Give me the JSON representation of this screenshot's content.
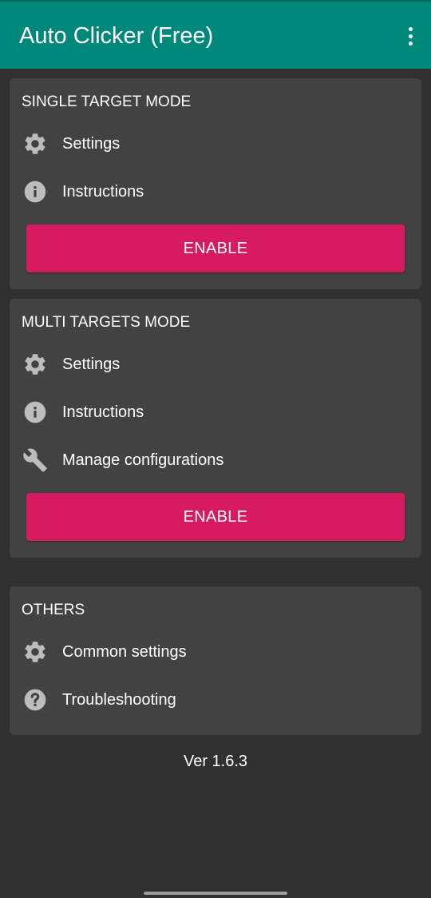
{
  "app": {
    "title": "Auto Clicker (Free)",
    "accent_color": "#00897b",
    "button_color": "#d81b60"
  },
  "single_target": {
    "title": "SINGLE TARGET MODE",
    "items": [
      {
        "label": "Settings",
        "icon": "gear-icon"
      },
      {
        "label": "Instructions",
        "icon": "info-icon"
      }
    ],
    "enable_label": "ENABLE"
  },
  "multi_targets": {
    "title": "MULTI TARGETS MODE",
    "items": [
      {
        "label": "Settings",
        "icon": "gear-icon"
      },
      {
        "label": "Instructions",
        "icon": "info-icon"
      },
      {
        "label": "Manage configurations",
        "icon": "wrench-icon"
      }
    ],
    "enable_label": "ENABLE"
  },
  "others": {
    "title": "OTHERS",
    "items": [
      {
        "label": "Common settings",
        "icon": "gear-icon"
      },
      {
        "label": "Troubleshooting",
        "icon": "help-icon"
      }
    ]
  },
  "version": "Ver 1.6.3"
}
